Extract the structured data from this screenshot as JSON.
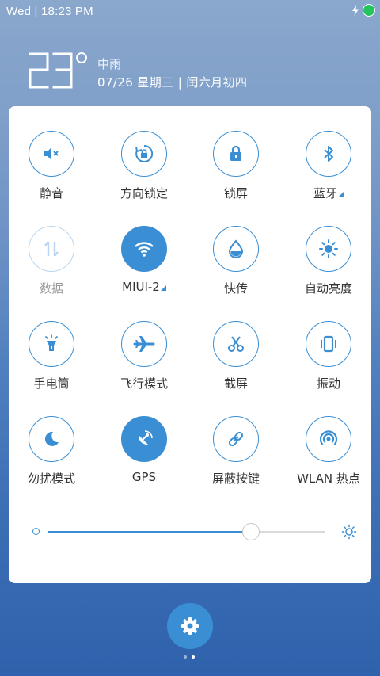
{
  "status_bar": {
    "time_text": "Wed | 18:23  PM",
    "icons": [
      "charging-bolt-icon",
      "battery-icon"
    ],
    "battery_color": "#22c55e"
  },
  "weather": {
    "temperature": "23",
    "condition": "中雨",
    "date_line": "07/26  星期三  |  闰六月初四"
  },
  "quick_settings": {
    "accent_color": "#3a8fd4",
    "tiles": [
      {
        "label": "静音",
        "icon": "mute-icon",
        "state": "off"
      },
      {
        "label": "方向锁定",
        "icon": "rotation-lock-icon",
        "state": "off"
      },
      {
        "label": "锁屏",
        "icon": "lock-icon",
        "state": "off"
      },
      {
        "label": "蓝牙",
        "icon": "bluetooth-icon",
        "state": "off",
        "expandable": true
      },
      {
        "label": "数据",
        "icon": "mobile-data-icon",
        "state": "disabled"
      },
      {
        "label": "MIUI-2",
        "icon": "wifi-icon",
        "state": "on",
        "expandable": true
      },
      {
        "label": "快传",
        "icon": "drop-icon",
        "state": "off"
      },
      {
        "label": "自动亮度",
        "icon": "auto-brightness-icon",
        "state": "off"
      },
      {
        "label": "手电筒",
        "icon": "flashlight-icon",
        "state": "off"
      },
      {
        "label": "飞行模式",
        "icon": "airplane-icon",
        "state": "off"
      },
      {
        "label": "截屏",
        "icon": "scissors-icon",
        "state": "off"
      },
      {
        "label": "振动",
        "icon": "vibrate-icon",
        "state": "off"
      },
      {
        "label": "勿扰模式",
        "icon": "moon-icon",
        "state": "off"
      },
      {
        "label": "GPS",
        "icon": "gps-icon",
        "state": "on"
      },
      {
        "label": "屏蔽按键",
        "icon": "link-icon",
        "state": "off"
      },
      {
        "label": "WLAN 热点",
        "icon": "hotspot-icon",
        "state": "off"
      }
    ]
  },
  "brightness": {
    "level": 0.73
  },
  "bottom": {
    "settings_icon": "gear-icon",
    "page_count": 2,
    "active_page": 2
  }
}
